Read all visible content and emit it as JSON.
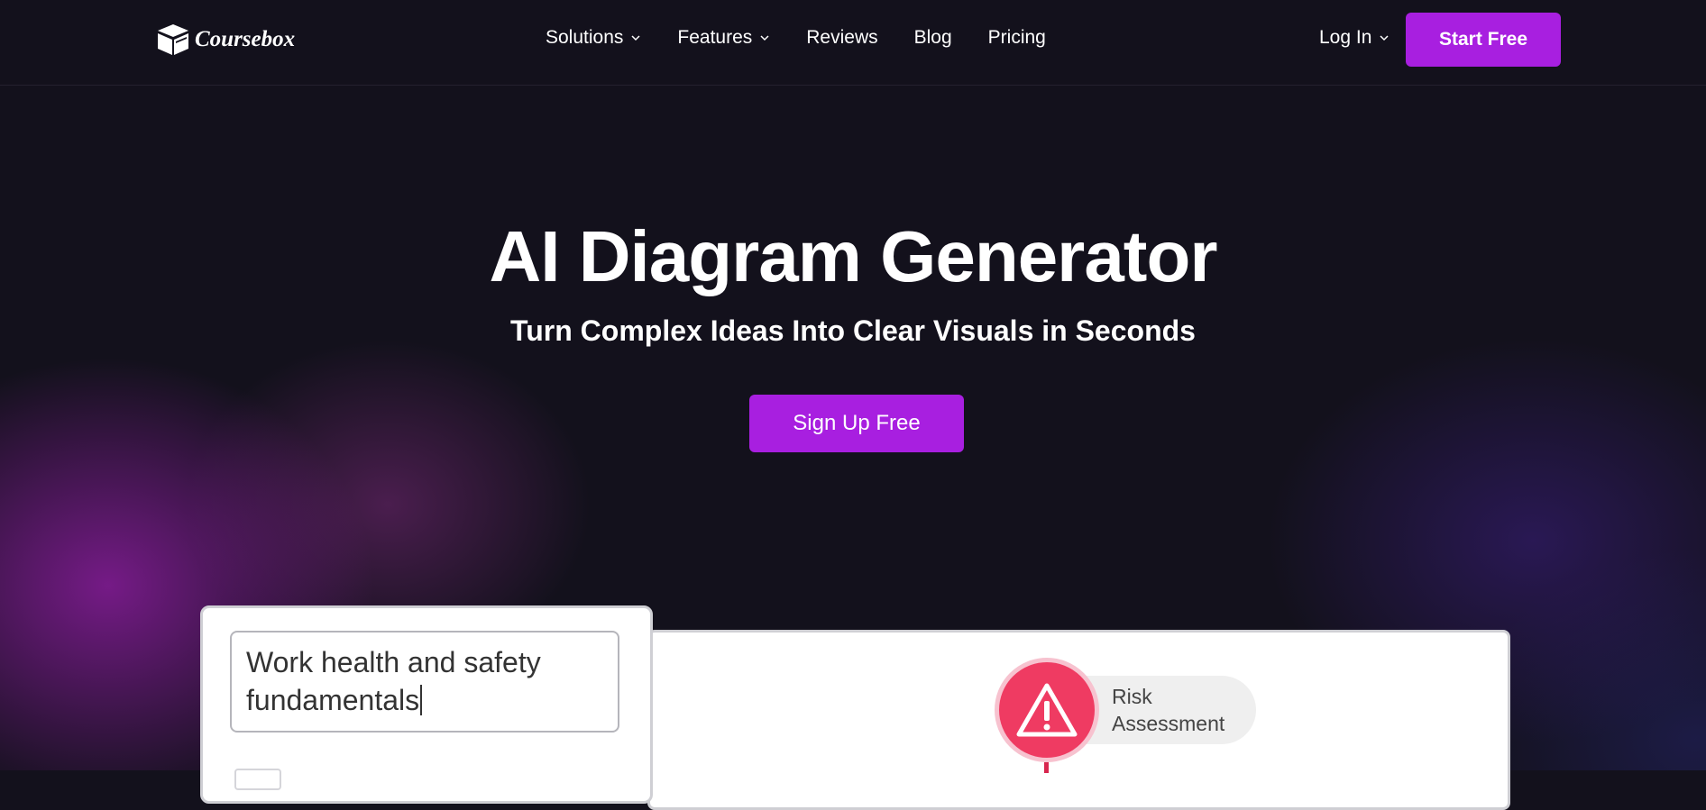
{
  "nav": {
    "logo_text": "Coursebox",
    "links": [
      {
        "label": "Solutions",
        "has_dropdown": true
      },
      {
        "label": "Features",
        "has_dropdown": true
      },
      {
        "label": "Reviews",
        "has_dropdown": false
      },
      {
        "label": "Blog",
        "has_dropdown": false
      },
      {
        "label": "Pricing",
        "has_dropdown": false
      }
    ],
    "login_label": "Log In",
    "start_free_label": "Start Free"
  },
  "hero": {
    "title": "AI Diagram Generator",
    "subtitle": "Turn Complex Ideas Into Clear Visuals in Seconds",
    "cta_label": "Sign Up Free"
  },
  "demo": {
    "input_value": "Work health and safety fundamentals",
    "node_label": "Risk Assessment",
    "node_icon": "warning-triangle-icon"
  },
  "colors": {
    "background": "#13111c",
    "accent": "#a81fe0",
    "node_red": "#ef3b62"
  }
}
